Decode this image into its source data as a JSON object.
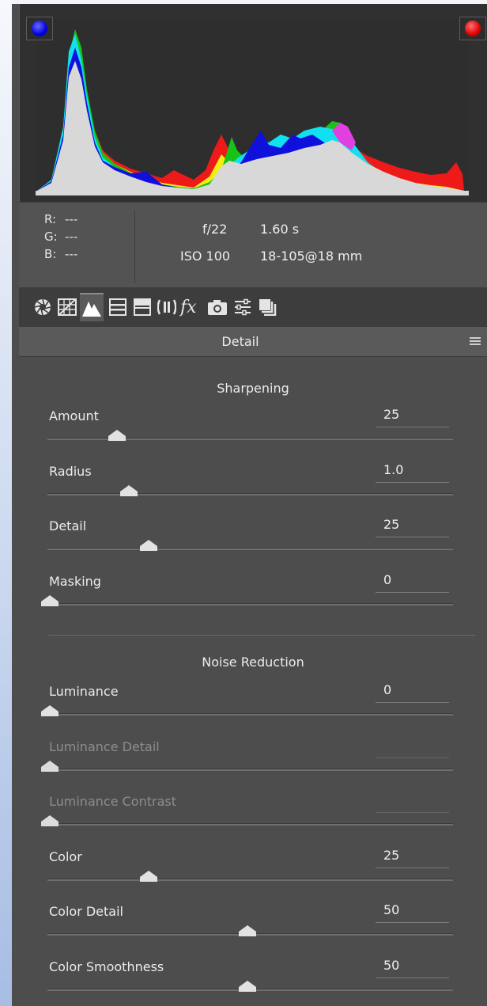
{
  "histogram": {
    "shadow_clip_color": "#0000ff",
    "highlight_clip_color": "#ff0000"
  },
  "info": {
    "r_label": "R:",
    "r_value": "---",
    "g_label": "G:",
    "g_value": "---",
    "b_label": "B:",
    "b_value": "---",
    "aperture": "f/22",
    "shutter": "1.60 s",
    "iso": "ISO 100",
    "lens": "18-105@18 mm"
  },
  "toolbar": {
    "tools": [
      {
        "name": "basic-icon"
      },
      {
        "name": "tone-curve-icon"
      },
      {
        "name": "detail-icon",
        "active": true
      },
      {
        "name": "hsl-icon"
      },
      {
        "name": "split-toning-icon"
      },
      {
        "name": "lens-corrections-icon"
      },
      {
        "name": "effects-icon"
      },
      {
        "name": "camera-calibration-icon"
      },
      {
        "name": "presets-icon"
      },
      {
        "name": "snapshots-icon"
      }
    ]
  },
  "panel": {
    "title": "Detail"
  },
  "sharpening": {
    "title": "Sharpening",
    "sliders": [
      {
        "label": "Amount",
        "value": "25",
        "level": 0.17
      },
      {
        "label": "Radius",
        "value": "1.0",
        "level": 0.2
      },
      {
        "label": "Detail",
        "value": "25",
        "level": 0.25
      },
      {
        "label": "Masking",
        "value": "0",
        "level": 0.0
      }
    ]
  },
  "noise_reduction": {
    "title": "Noise Reduction",
    "sliders": [
      {
        "label": "Luminance",
        "value": "0",
        "level": 0.0,
        "disabled": false
      },
      {
        "label": "Luminance Detail",
        "value": "",
        "level": 0.0,
        "disabled": true
      },
      {
        "label": "Luminance Contrast",
        "value": "",
        "level": 0.0,
        "disabled": true
      },
      {
        "label": "Color",
        "value": "25",
        "level": 0.25,
        "disabled": false
      },
      {
        "label": "Color Detail",
        "value": "50",
        "level": 0.5,
        "disabled": false
      },
      {
        "label": "Color Smoothness",
        "value": "50",
        "level": 0.5,
        "disabled": false
      }
    ]
  }
}
